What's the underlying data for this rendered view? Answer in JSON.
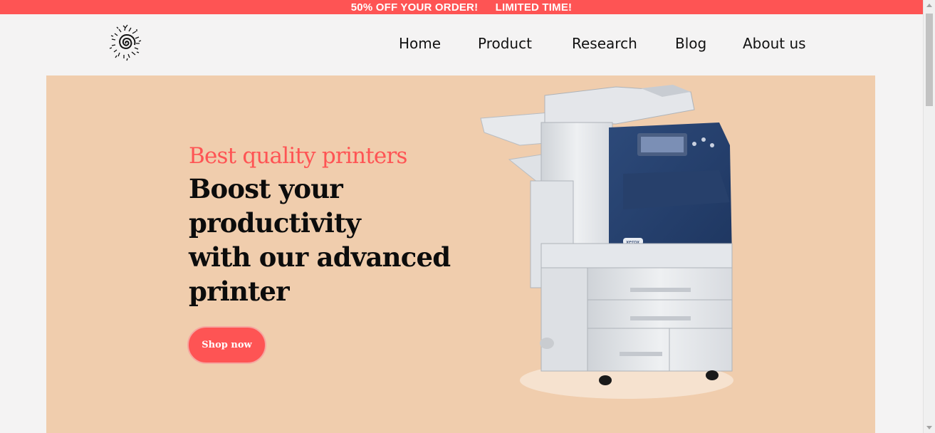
{
  "promo": {
    "offer": "50% OFF YOUR ORDER!",
    "limited": "LIMITED TIME!"
  },
  "nav": {
    "items": [
      {
        "label": "Home"
      },
      {
        "label": "Product"
      },
      {
        "label": "Research"
      },
      {
        "label": "Blog"
      },
      {
        "label": "About us"
      }
    ]
  },
  "hero": {
    "subtitle": "Best quality printers",
    "title_lines": [
      "Boost your",
      "productivity",
      "with our advanced",
      "printer"
    ],
    "cta_label": "Shop now"
  },
  "printer_brand": "xerox",
  "colors": {
    "accent": "#fe5454",
    "hero_bg": "#f0cdad",
    "page_bg": "#f4f3f3",
    "text": "#0c0c0c"
  },
  "icons": {
    "logo": "spiral-sun-logo"
  }
}
